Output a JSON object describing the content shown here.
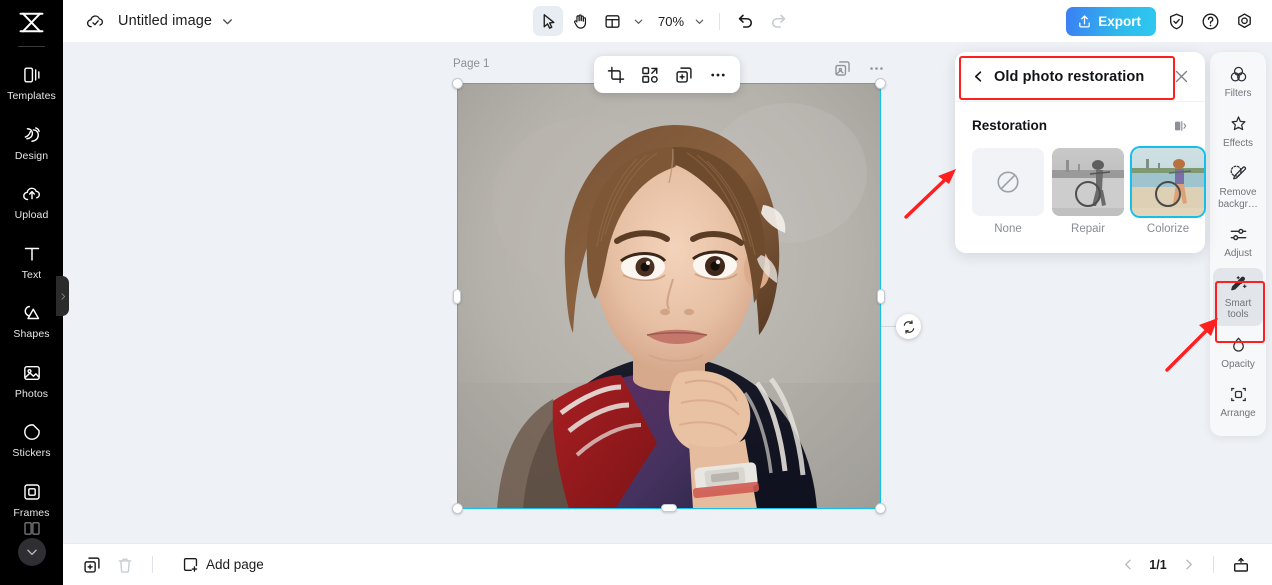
{
  "app": {
    "logo_icon": "capcut-logo-icon"
  },
  "document": {
    "title": "Untitled image",
    "cloud_icon": "cloud-saved-icon",
    "caret_icon": "chevron-down-icon"
  },
  "toolbar": {
    "select_icon": "cursor-select-icon",
    "hand_icon": "hand-pan-icon",
    "layout_icon": "page-layout-icon",
    "layout_caret_icon": "chevron-down-icon",
    "zoom_level": "70%",
    "zoom_caret_icon": "chevron-down-icon",
    "undo_icon": "undo-icon",
    "redo_icon": "redo-icon",
    "export_label": "Export",
    "export_icon": "upload-share-icon",
    "shield_icon": "shield-check-icon",
    "help_icon": "question-circle-icon",
    "settings_icon": "gear-icon",
    "export_gradient_from": "#3b7ef4",
    "export_gradient_to": "#2ec9f0"
  },
  "left_sidebar": {
    "items": [
      {
        "label": "Templates",
        "icon": "templates-icon"
      },
      {
        "label": "Design",
        "icon": "design-icon"
      },
      {
        "label": "Upload",
        "icon": "upload-cloud-icon"
      },
      {
        "label": "Text",
        "icon": "text-icon"
      },
      {
        "label": "Shapes",
        "icon": "shapes-icon"
      },
      {
        "label": "Photos",
        "icon": "photos-icon"
      },
      {
        "label": "Stickers",
        "icon": "stickers-icon"
      },
      {
        "label": "Frames",
        "icon": "frames-icon"
      }
    ],
    "collapse_icon": "chevron-right-icon",
    "more_icon": "chevron-down-icon"
  },
  "canvas": {
    "page_label": "Page 1",
    "selection_color": "#15c0e8",
    "float_toolbar": [
      {
        "name": "crop-button",
        "icon": "crop-icon"
      },
      {
        "name": "cutout-button",
        "icon": "cutout-icon"
      },
      {
        "name": "duplicate-button",
        "icon": "duplicate-icon"
      },
      {
        "name": "more-options-button",
        "icon": "more-dots-icon"
      }
    ],
    "canvas_controls": [
      {
        "name": "duplicate-page-button",
        "icon": "duplicate-page-icon"
      },
      {
        "name": "page-more-button",
        "icon": "more-dots-icon"
      }
    ],
    "rotate_icon": "rotate-icon"
  },
  "panel": {
    "title": "Old photo restoration",
    "back_icon": "chevron-left-icon",
    "close_icon": "close-icon",
    "section_title": "Restoration",
    "compare_icon": "compare-split-icon",
    "options": [
      {
        "label": "None",
        "selected": false,
        "icon": "no-effect-icon"
      },
      {
        "label": "Repair",
        "selected": false
      },
      {
        "label": "Colorize",
        "selected": true
      }
    ]
  },
  "right_rail": {
    "items": [
      {
        "label": "Filters",
        "icon": "filters-icon",
        "active": false
      },
      {
        "label": "Effects",
        "icon": "effects-icon",
        "active": false
      },
      {
        "label": "Remove backgr…",
        "icon": "remove-background-icon",
        "active": false
      },
      {
        "label": "Adjust",
        "icon": "adjust-sliders-icon",
        "active": false
      },
      {
        "label": "Smart tools",
        "icon": "smart-tools-icon",
        "active": true
      },
      {
        "label": "Opacity",
        "icon": "opacity-drop-icon",
        "active": false
      },
      {
        "label": "Arrange",
        "icon": "arrange-icon",
        "active": false
      }
    ]
  },
  "bottom_bar": {
    "duplicate_icon": "duplicate-icon",
    "delete_icon": "trash-icon",
    "add_page_label": "Add page",
    "add_page_icon": "add-page-icon",
    "prev_icon": "chevron-left-icon",
    "page_indicator": "1/1",
    "next_icon": "chevron-right-icon",
    "present_icon": "present-icon"
  },
  "annotations": {
    "highlight_color": "#ff1f1f",
    "boxes": [
      {
        "name": "panel-title-highlight"
      },
      {
        "name": "smart-tools-highlight"
      }
    ],
    "arrows": [
      {
        "name": "arrow-to-panel"
      },
      {
        "name": "arrow-to-smart-tools"
      }
    ]
  }
}
